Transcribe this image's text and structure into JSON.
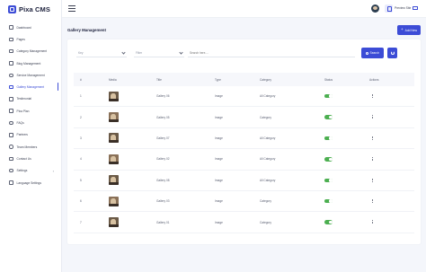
{
  "brand": {
    "name": "Pixa CMS",
    "accent": "#3c4cd6"
  },
  "topbar": {
    "preview_label": "Preview Site"
  },
  "sidebar": {
    "items": [
      {
        "label": "Dashboard",
        "icon": "home-icon"
      },
      {
        "label": "Pages",
        "icon": "page-icon"
      },
      {
        "label": "Category Management",
        "icon": "category-icon"
      },
      {
        "label": "Blog Management",
        "icon": "blog-icon"
      },
      {
        "label": "Service Management",
        "icon": "service-icon"
      },
      {
        "label": "Gallery Management",
        "icon": "gallery-icon",
        "active": true
      },
      {
        "label": "Testimonial",
        "icon": "testimonial-icon"
      },
      {
        "label": "Pixa Plan",
        "icon": "plan-icon"
      },
      {
        "label": "FAQs",
        "icon": "faq-icon"
      },
      {
        "label": "Partners",
        "icon": "partners-icon"
      },
      {
        "label": "Team Members",
        "icon": "team-icon"
      },
      {
        "label": "Contact Us",
        "icon": "contact-icon"
      },
      {
        "label": "Settings",
        "icon": "gear-icon",
        "has_children": true
      },
      {
        "label": "Language Settings",
        "icon": "language-icon"
      }
    ]
  },
  "main": {
    "title": "Gallery Management",
    "add_label": "Add New",
    "filters": {
      "key_placeholder": "Key",
      "filter_placeholder": "Filter",
      "search_placeholder": "Search here....",
      "search_label": "Search"
    },
    "table": {
      "headers": [
        "#",
        "Media",
        "Title",
        "Type",
        "Category",
        "Status",
        "Actions"
      ],
      "rows": [
        {
          "idx": "1",
          "title": "Gallery 06",
          "type": "Image",
          "category": "All Category",
          "status": true
        },
        {
          "idx": "2",
          "title": "Gallery 05",
          "type": "Image",
          "category": "Category",
          "status": true
        },
        {
          "idx": "3",
          "title": "Gallery 07",
          "type": "Image",
          "category": "All Category",
          "status": true
        },
        {
          "idx": "4",
          "title": "Gallery 02",
          "type": "Image",
          "category": "All Category",
          "status": true
        },
        {
          "idx": "5",
          "title": "Gallery 08",
          "type": "Image",
          "category": "All Category",
          "status": true
        },
        {
          "idx": "6",
          "title": "Gallery 03",
          "type": "Image",
          "category": "Category",
          "status": true
        },
        {
          "idx": "7",
          "title": "Gallery 01",
          "type": "Image",
          "category": "Category",
          "status": true
        }
      ]
    }
  }
}
